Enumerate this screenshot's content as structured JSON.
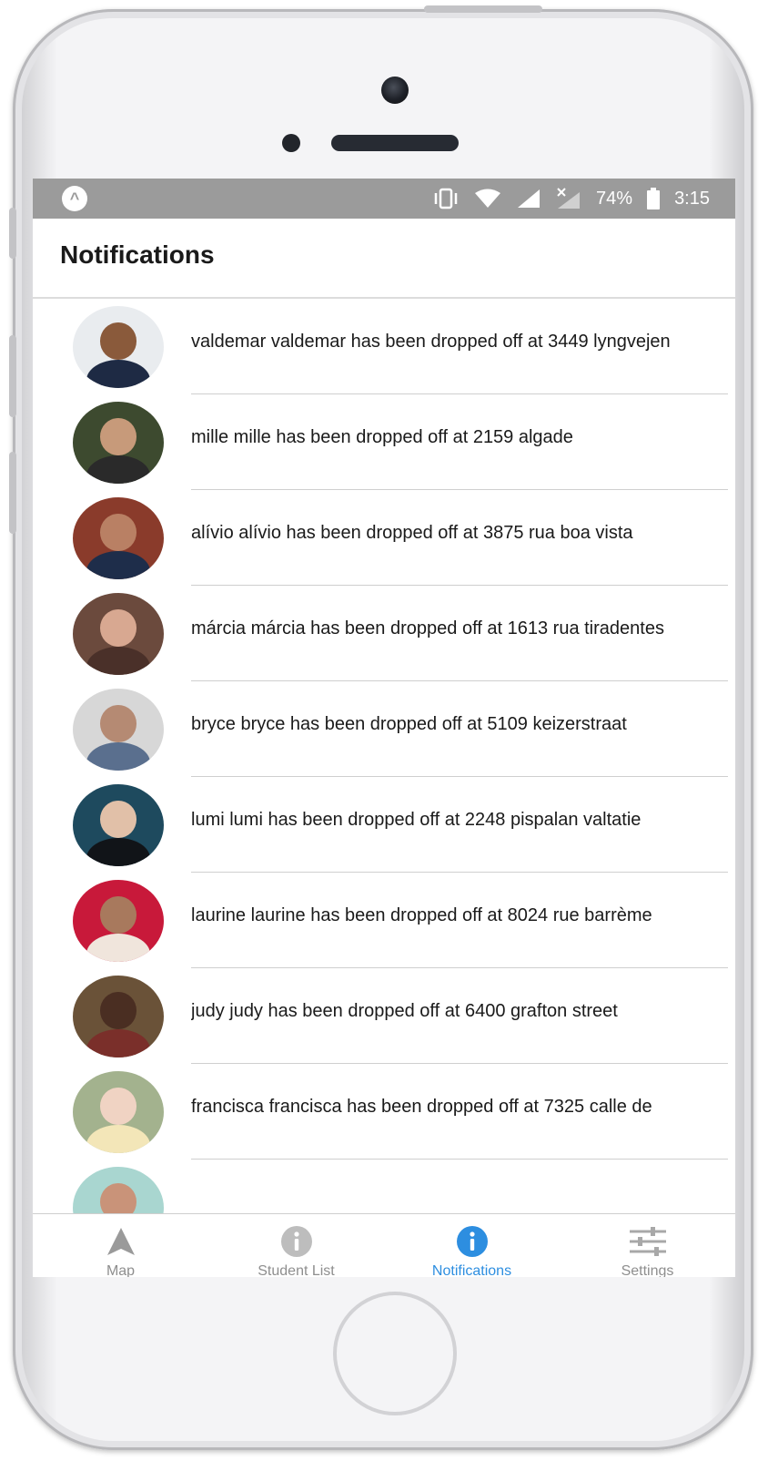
{
  "status_bar": {
    "battery": "74%",
    "time": "3:15"
  },
  "header": {
    "title": "Notifications"
  },
  "notifications": [
    {
      "text": "valdemar valdemar has been dropped off at 3449 lyngvejen",
      "avatar_bg": "#e9ecef",
      "avatar_face": "#8a5a3b",
      "avatar_body": "#1e2a44"
    },
    {
      "text": "mille mille has been dropped off at 2159 algade",
      "avatar_bg": "#3d4a2f",
      "avatar_face": "#c79a7a",
      "avatar_body": "#2a2a2a"
    },
    {
      "text": "alívio alívio has been dropped off at 3875 rua boa vista",
      "avatar_bg": "#8a3b2b",
      "avatar_face": "#b98064",
      "avatar_body": "#1e2d4a"
    },
    {
      "text": "márcia márcia has been dropped off at 1613 rua tiradentes",
      "avatar_bg": "#6b4a3d",
      "avatar_face": "#d8a891",
      "avatar_body": "#4a3029"
    },
    {
      "text": "bryce bryce has been dropped off at 5109 keizerstraat",
      "avatar_bg": "#d7d7d7",
      "avatar_face": "#b58a73",
      "avatar_body": "#5a6f8e"
    },
    {
      "text": "lumi lumi has been dropped off at 2248 pispalan valtatie",
      "avatar_bg": "#1e4a5e",
      "avatar_face": "#e1c0a8",
      "avatar_body": "#111418"
    },
    {
      "text": "laurine laurine has been dropped off at 8024 rue barrème",
      "avatar_bg": "#c8193a",
      "avatar_face": "#a8795d",
      "avatar_body": "#f0e5dc"
    },
    {
      "text": "judy judy has been dropped off at 6400 grafton street",
      "avatar_bg": "#6a5238",
      "avatar_face": "#4a2e22",
      "avatar_body": "#7a2f2a"
    },
    {
      "text": "francisca francisca has been dropped off at 7325 calle de",
      "avatar_bg": "#a3b28e",
      "avatar_face": "#f0d3c3",
      "avatar_body": "#f3e6b8"
    },
    {
      "text": "",
      "avatar_bg": "#a9d6d0",
      "avatar_face": "#c99379",
      "avatar_body": "#3a3a3a"
    }
  ],
  "tabs": [
    {
      "label": "Map",
      "icon": "navigation-arrow-icon",
      "active": false
    },
    {
      "label": "Student List",
      "icon": "info-icon",
      "active": false
    },
    {
      "label": "Notifications",
      "icon": "info-icon",
      "active": true
    },
    {
      "label": "Settings",
      "icon": "sliders-icon",
      "active": false
    }
  ],
  "colors": {
    "status_bar": "#9b9b9b",
    "accent": "#2d8ee0",
    "tab_inactive": "#8e8e8e",
    "divider": "#cfcfcf"
  }
}
